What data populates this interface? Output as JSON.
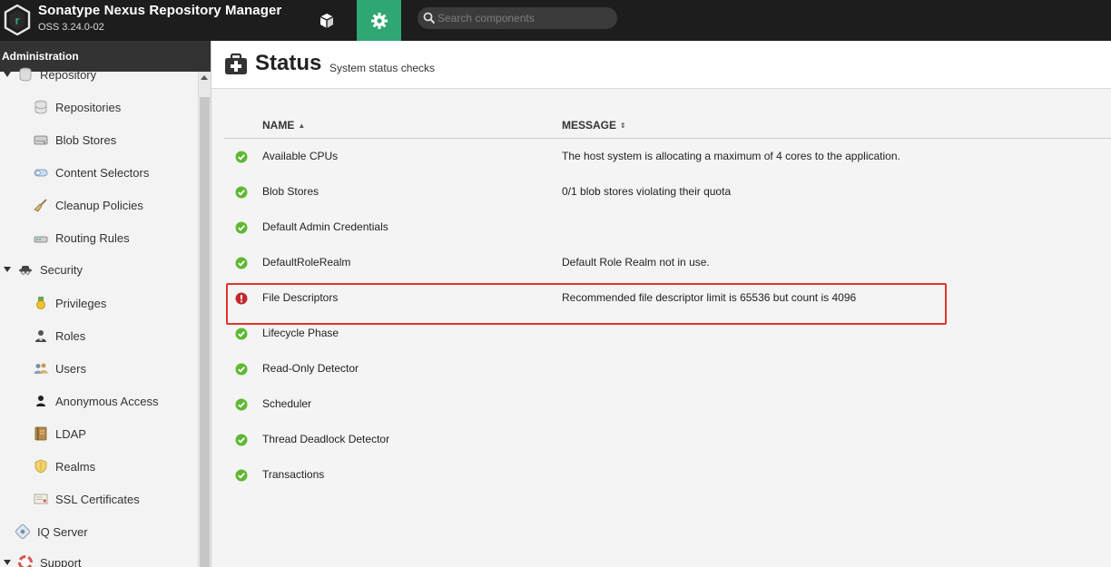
{
  "app": {
    "title": "Sonatype Nexus Repository Manager",
    "version": "OSS 3.24.0-02",
    "accent": "#2ea773"
  },
  "search": {
    "placeholder": "Search components"
  },
  "sidebar": {
    "header": "Administration",
    "items": [
      {
        "label": "Repository",
        "icon": "database-icon",
        "level": 0
      },
      {
        "label": "Repositories",
        "icon": "database-icon",
        "level": 1
      },
      {
        "label": "Blob Stores",
        "icon": "drive-icon",
        "level": 1
      },
      {
        "label": "Content Selectors",
        "icon": "selector-icon",
        "level": 1
      },
      {
        "label": "Cleanup Policies",
        "icon": "broom-icon",
        "level": 1
      },
      {
        "label": "Routing Rules",
        "icon": "router-icon",
        "level": 1
      },
      {
        "label": "Security",
        "icon": "spy-icon",
        "level": 0
      },
      {
        "label": "Privileges",
        "icon": "medal-icon",
        "level": 1
      },
      {
        "label": "Roles",
        "icon": "role-icon",
        "level": 1
      },
      {
        "label": "Users",
        "icon": "users-icon",
        "level": 1
      },
      {
        "label": "Anonymous Access",
        "icon": "user-icon",
        "level": 1
      },
      {
        "label": "LDAP",
        "icon": "book-icon",
        "level": 1
      },
      {
        "label": "Realms",
        "icon": "shield-icon",
        "level": 1
      },
      {
        "label": "SSL Certificates",
        "icon": "certificate-icon",
        "level": 1
      },
      {
        "label": "IQ Server",
        "icon": "iq-icon",
        "level": 0
      },
      {
        "label": "Support",
        "icon": "lifebuoy-icon",
        "level": 0
      }
    ]
  },
  "page": {
    "title": "Status",
    "subtitle": "System status checks"
  },
  "table": {
    "columns": [
      "NAME",
      "MESSAGE"
    ],
    "rows": [
      {
        "name": "Available CPUs",
        "message": "The host system is allocating a maximum of 4 cores to the application.",
        "status": "ok"
      },
      {
        "name": "Blob Stores",
        "message": "0/1 blob stores violating their quota",
        "status": "ok"
      },
      {
        "name": "Default Admin Credentials",
        "message": "",
        "status": "ok"
      },
      {
        "name": "DefaultRoleRealm",
        "message": "Default Role Realm not in use.",
        "status": "ok"
      },
      {
        "name": "File Descriptors",
        "message": "Recommended file descriptor limit is 65536 but count is 4096",
        "status": "error"
      },
      {
        "name": "Lifecycle Phase",
        "message": "",
        "status": "ok"
      },
      {
        "name": "Read-Only Detector",
        "message": "",
        "status": "ok"
      },
      {
        "name": "Scheduler",
        "message": "",
        "status": "ok"
      },
      {
        "name": "Thread Deadlock Detector",
        "message": "",
        "status": "ok"
      },
      {
        "name": "Transactions",
        "message": "",
        "status": "ok"
      }
    ]
  },
  "colors": {
    "ok": "#5fb832",
    "error": "#c1272d",
    "highlight": "#e0342a"
  }
}
